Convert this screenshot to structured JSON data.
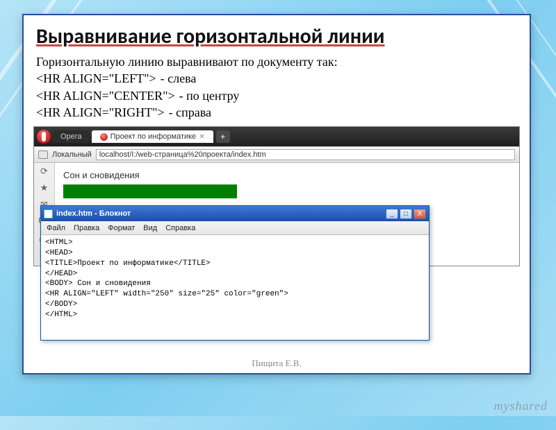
{
  "slide": {
    "title": "Выравнивание горизонтальной линии",
    "intro": "Горизонтальную линию выравнивают по документу так:",
    "lines": [
      {
        "code": "<HR ALIGN=\"LEFT\">",
        "desc": "- слева"
      },
      {
        "code": "<HR ALIGN=\"CENTER\">",
        "desc": "- по центру"
      },
      {
        "code": "<HR ALIGN=\"RIGHT\">",
        "desc": "- справа"
      }
    ]
  },
  "browser": {
    "app_tab": "Opera",
    "active_tab": "Проект по информатике",
    "addr_label": "Локальный",
    "addr_url": "localhost/I:/web-страница%20проекта/index.htm",
    "page_heading": "Сон и сновидения"
  },
  "notepad": {
    "title": "index.htm - Блокнот",
    "menu": [
      "Файл",
      "Правка",
      "Формат",
      "Вид",
      "Справка"
    ],
    "code": "<HTML>\n<HEAD>\n<TITLE>Проект по информатике</TITLE>\n</HEAD>\n<BODY> Сон и сновидения\n<HR ALIGN=\"LEFT\" width=\"250\" size=\"25\" color=\"green\">\n</BODY>\n</HTML>"
  },
  "footer": {
    "author": "Пищита Е.В.",
    "watermark": "myshared"
  },
  "win_btns": {
    "min": "_",
    "max": "□",
    "close": "X"
  }
}
